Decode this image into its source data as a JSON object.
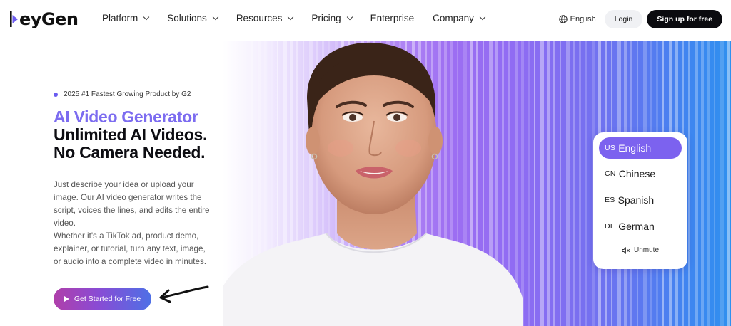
{
  "brand": {
    "name": "HeyGen",
    "logo_text": "eyGen"
  },
  "nav": {
    "items": [
      {
        "label": "Platform",
        "has_dropdown": true
      },
      {
        "label": "Solutions",
        "has_dropdown": true
      },
      {
        "label": "Resources",
        "has_dropdown": true
      },
      {
        "label": "Pricing",
        "has_dropdown": true
      },
      {
        "label": "Enterprise",
        "has_dropdown": false
      },
      {
        "label": "Company",
        "has_dropdown": true
      }
    ],
    "language": "English",
    "login": "Login",
    "signup": "Sign up for free"
  },
  "hero": {
    "badge": "2025 #1 Fastest Growing Product by G2",
    "headline_accent": "AI Video Generator",
    "headline_line2": "Unlimited AI Videos.",
    "headline_line3": "No Camera Needed.",
    "description_p1": "Just describe your idea or upload your image. Our AI video generator writes the script, voices the lines, and edits the entire video.",
    "description_p2": "Whether it's a TikTok ad, product demo, explainer, or tutorial, turn any text, image, or audio into a complete video in minutes.",
    "cta": "Get Started for Free"
  },
  "language_panel": {
    "options": [
      {
        "code": "US",
        "label": "English",
        "active": true
      },
      {
        "code": "CN",
        "label": "Chinese",
        "active": false
      },
      {
        "code": "ES",
        "label": "Spanish",
        "active": false
      },
      {
        "code": "DE",
        "label": "German",
        "active": false
      }
    ],
    "unmute": "Unmute"
  },
  "colors": {
    "accent": "#7c6cf0",
    "cta_gradient": [
      "#b03faa",
      "#8a4bd4",
      "#4e70e6"
    ],
    "active_language": "#7c62ef",
    "signup_bg": "#0b0b0f"
  }
}
